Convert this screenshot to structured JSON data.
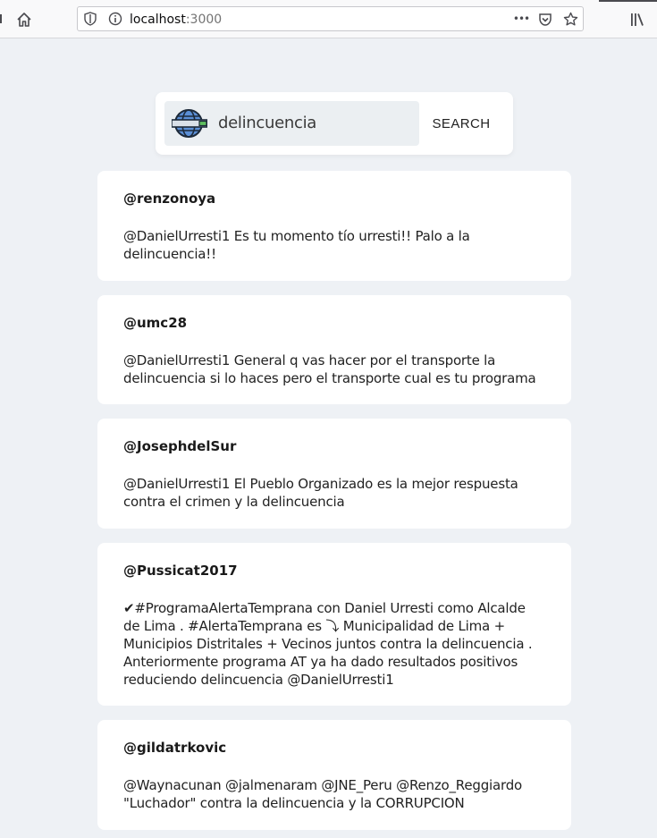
{
  "browser": {
    "url_host": "localhost",
    "url_port": ":3000",
    "menu_dots": "•••"
  },
  "search": {
    "value": "delincuencia",
    "button_label": "SEARCH"
  },
  "tweets": [
    {
      "user": "@renzonoya",
      "text": "@DanielUrresti1 Es tu momento tío urresti!! Palo a la delincuencia!!"
    },
    {
      "user": "@umc28",
      "text": "@DanielUrresti1 General q vas hacer por el transporte la delincuencia si lo haces pero el transporte cual es tu programa"
    },
    {
      "user": "@JosephdelSur",
      "text": "@DanielUrresti1 El Pueblo Organizado es la mejor respuesta contra el crimen y la delincuencia"
    },
    {
      "user": "@Pussicat2017",
      "text": "✔#ProgramaAlertaTemprana con Daniel Urresti como Alcalde de Lima . #AlertaTemprana es ⤵ Municipalidad de Lima + Municipios Distritales + Vecinos juntos contra la delincuencia . Anteriormente programa AT ya ha dado resultados positivos reduciendo delincuencia @DanielUrresti1"
    },
    {
      "user": "@gildatrkovic",
      "text": "@Waynacunan @jalmenaram @JNE_Peru @Renzo_Reggiardo \"Luchador\" contra la delincuencia y la CORRUPCION"
    }
  ]
}
